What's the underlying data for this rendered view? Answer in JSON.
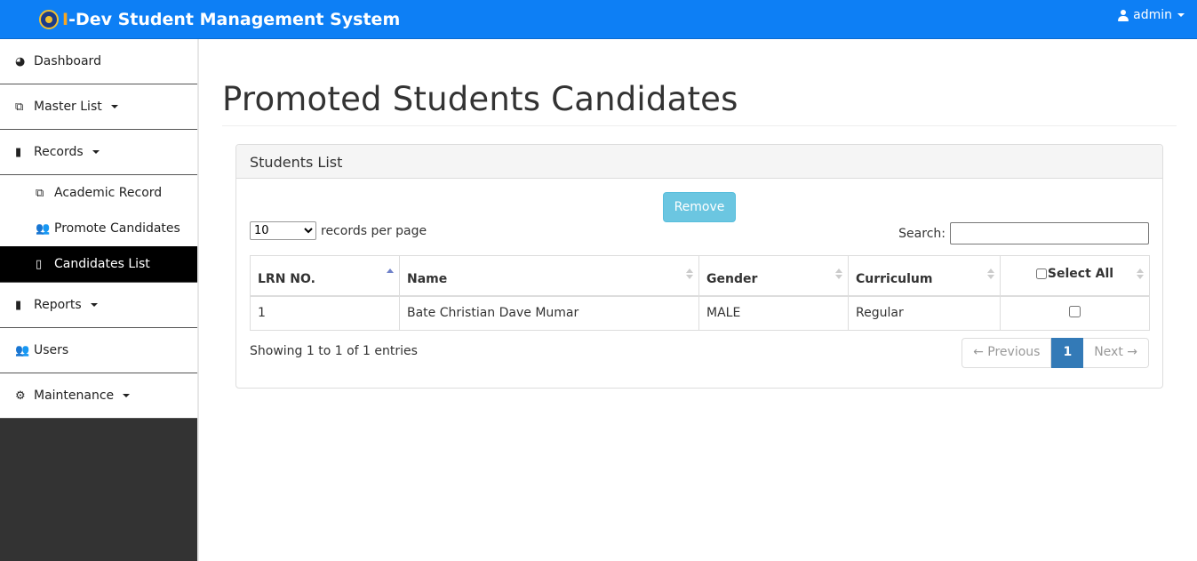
{
  "navbar": {
    "brand_i": "I",
    "brand_text": "-Dev Student Management System",
    "user": "admin"
  },
  "sidebar": {
    "items": [
      {
        "label": "Dashboard",
        "icon": "dashboard-icon"
      },
      {
        "label": "Master List",
        "icon": "copy-icon"
      },
      {
        "label": "Records",
        "icon": "file-icon"
      },
      {
        "label": "Reports",
        "icon": "file-icon"
      },
      {
        "label": "Users",
        "icon": "users-icon"
      },
      {
        "label": "Maintenance",
        "icon": "gears-icon"
      }
    ],
    "records_submenu": [
      {
        "label": "Academic Record",
        "icon": "copy-icon"
      },
      {
        "label": "Promote Candidates",
        "icon": "users-icon"
      },
      {
        "label": "Candidates List",
        "icon": "file-outline-icon",
        "active": true
      }
    ]
  },
  "main": {
    "title": "Promoted Students Candidates",
    "panel_title": "Students List",
    "remove_label": "Remove",
    "length_value": "10",
    "length_suffix": "records per page",
    "search_label": "Search:",
    "search_value": "",
    "columns": [
      "LRN NO.",
      "Name",
      "Gender",
      "Curriculum",
      "Select All"
    ],
    "rows": [
      {
        "lrn": "1",
        "name": "Bate Christian Dave Mumar",
        "gender": "MALE",
        "curriculum": "Regular"
      }
    ],
    "info": "Showing 1 to 1 of 1 entries",
    "pagination": {
      "prev": "← Previous",
      "current": "1",
      "next": "Next →"
    }
  },
  "colors": {
    "navbar": "#0d7ff5",
    "brand_accent": "#f5a623",
    "remove_button": "#5bc0de",
    "active_page": "#337ab7",
    "active_sidebar": "#000000"
  }
}
